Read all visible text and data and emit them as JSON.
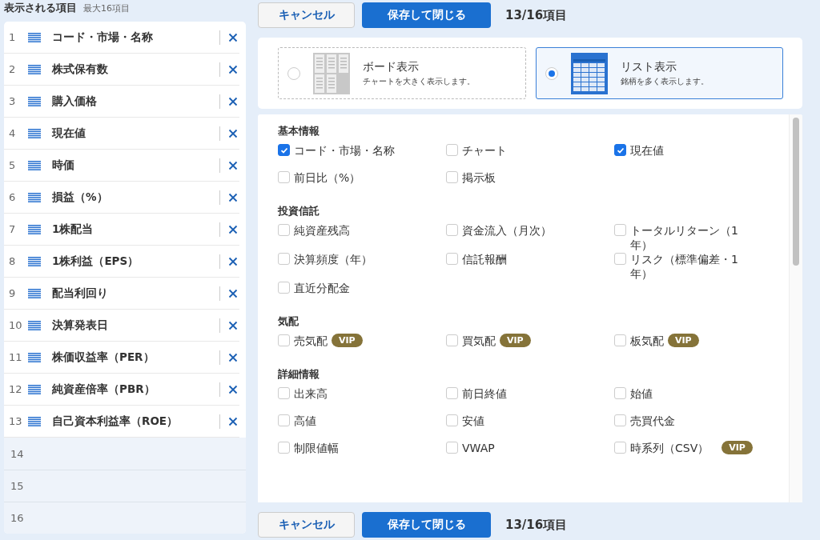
{
  "selected_panel": {
    "title": "表示される項目",
    "limit": "最大16項目",
    "slots": [
      {
        "kind": "filled",
        "number": "1",
        "label": "コード・市場・名称"
      },
      {
        "kind": "filled",
        "number": "2",
        "label": "株式保有数"
      },
      {
        "kind": "filled",
        "number": "3",
        "label": "購入価格"
      },
      {
        "kind": "filled",
        "number": "4",
        "label": "現在値"
      },
      {
        "kind": "filled",
        "number": "5",
        "label": "時価"
      },
      {
        "kind": "filled",
        "number": "6",
        "label": "損益（%）"
      },
      {
        "kind": "filled",
        "number": "7",
        "label": "1株配当"
      },
      {
        "kind": "filled",
        "number": "8",
        "label": "1株利益（EPS）"
      },
      {
        "kind": "filled",
        "number": "9",
        "label": "配当利回り"
      },
      {
        "kind": "filled",
        "number": "10",
        "label": "決算発表日"
      },
      {
        "kind": "filled",
        "number": "11",
        "label": "株価収益率（PER）"
      },
      {
        "kind": "filled",
        "number": "12",
        "label": "純資産倍率（PBR）"
      },
      {
        "kind": "filled",
        "number": "13",
        "label": "自己資本利益率（ROE）"
      },
      {
        "kind": "empty",
        "number": "14"
      },
      {
        "kind": "empty",
        "number": "15"
      },
      {
        "kind": "empty",
        "number": "16"
      }
    ]
  },
  "top_actions": {
    "cancel": "キャンセル",
    "save": "保存して閉じる",
    "count": "13/16項目"
  },
  "view_modes": [
    {
      "kind": "board",
      "title": "ボード表示",
      "description": "チャートを大きく表示します。",
      "selected": false
    },
    {
      "kind": "list",
      "title": "リスト表示",
      "description": "銘柄を多く表示します。",
      "selected": true
    }
  ],
  "sections": [
    {
      "title": "基本情報",
      "items": [
        {
          "label": "コード・市場・名称",
          "checked": true
        },
        {
          "label": "チャート",
          "checked": false
        },
        {
          "label": "現在値",
          "checked": true
        },
        {
          "label": "前日比（%）",
          "checked": false
        },
        {
          "label": "掲示板",
          "checked": false
        }
      ]
    },
    {
      "title": "投資信託",
      "items": [
        {
          "label": "純資産残高",
          "checked": false
        },
        {
          "label": "資金流入（月次）",
          "checked": false
        },
        {
          "label": "トータルリターン（1年）",
          "checked": false
        },
        {
          "label": "決算頻度（年）",
          "checked": false
        },
        {
          "label": "信託報酬",
          "checked": false
        },
        {
          "label": "リスク（標準偏差・1年）",
          "checked": false
        },
        {
          "label": "直近分配金",
          "checked": false
        }
      ]
    },
    {
      "title": "気配",
      "items": [
        {
          "label": "売気配",
          "checked": false,
          "badge": "VIP"
        },
        {
          "label": "買気配",
          "checked": false,
          "badge": "VIP"
        },
        {
          "label": "板気配",
          "checked": false,
          "badge": "VIP"
        }
      ]
    },
    {
      "title": "詳細情報",
      "items": [
        {
          "label": "出来高",
          "checked": false
        },
        {
          "label": "前日終値",
          "checked": false
        },
        {
          "label": "始値",
          "checked": false
        },
        {
          "label": "高値",
          "checked": false
        },
        {
          "label": "安値",
          "checked": false
        },
        {
          "label": "売買代金",
          "checked": false
        },
        {
          "label": "制限値幅",
          "checked": false
        },
        {
          "label": "VWAP",
          "checked": false
        },
        {
          "label": "時系列（CSV）",
          "checked": false,
          "badge": "VIP"
        }
      ]
    }
  ],
  "bottom_actions": {
    "cancel": "キャンセル",
    "save": "保存して閉じる",
    "count": "13/16項目"
  }
}
